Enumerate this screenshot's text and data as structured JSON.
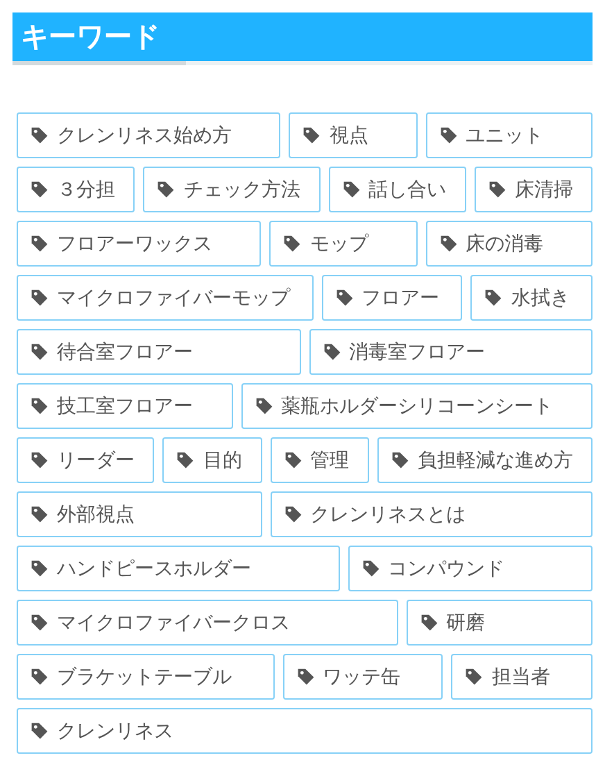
{
  "header": {
    "title": "キーワード"
  },
  "tag_rows": [
    [
      "クレンリネス始め方",
      "視点",
      "ユニット"
    ],
    [
      "３分担",
      "チェック方法",
      "話し合い",
      "床清掃"
    ],
    [
      "フロアーワックス",
      "モップ",
      "床の消毒"
    ],
    [
      "マイクロファイバーモップ",
      "フロアー",
      "水拭き"
    ],
    [
      "待合室フロアー",
      "消毒室フロアー"
    ],
    [
      "技工室フロアー",
      "薬瓶ホルダーシリコーンシート"
    ],
    [
      "リーダー",
      "目的",
      "管理",
      "負担軽減な進め方"
    ],
    [
      "外部視点",
      "クレンリネスとは"
    ],
    [
      "ハンドピースホルダー",
      "コンパウンド"
    ],
    [
      "マイクロファイバークロス",
      "研磨"
    ],
    [
      "ブラケットテーブル",
      "ワッテ缶",
      "担当者"
    ],
    [
      "クレンリネス"
    ]
  ]
}
